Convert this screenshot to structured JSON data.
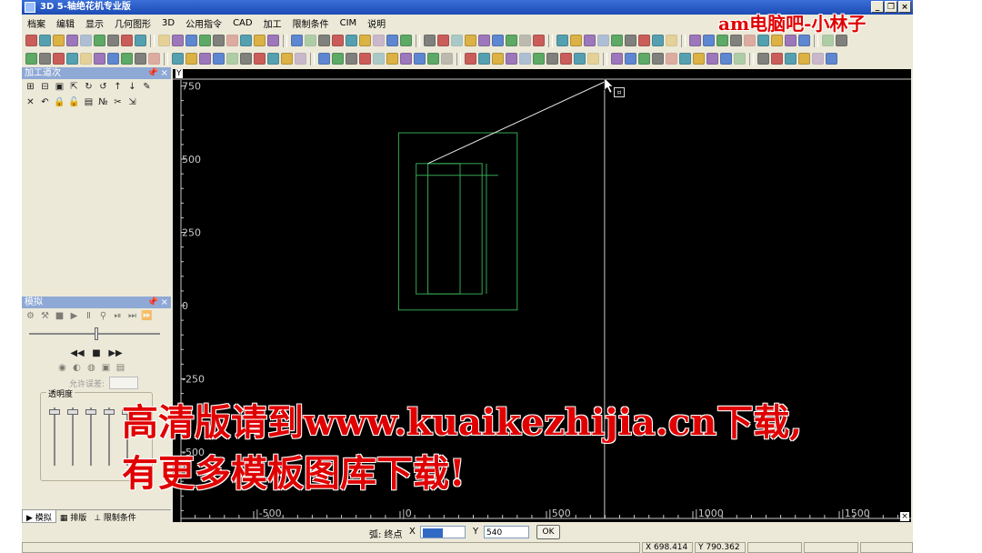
{
  "title_bar": {
    "title": "3D 5-轴绝花机专业版",
    "buttons": [
      "_",
      "❐",
      "×"
    ]
  },
  "menu": [
    "档案",
    "编辑",
    "显示",
    "几何图形",
    "3D",
    "公用指令",
    "CAD",
    "加工",
    "限制条件",
    "CIM",
    "说明"
  ],
  "panels": {
    "machining": {
      "title": "加工道次",
      "pin": "📌",
      "close": "×"
    },
    "simulation": {
      "title": "模拟",
      "pin": "📌",
      "close": "×",
      "allowed_error_label": "允许误差:",
      "transparency_label": "透明度"
    }
  },
  "bottom_tabs": [
    "模拟",
    "排版",
    "限制条件"
  ],
  "canvas": {
    "y_axis_label": "Y",
    "y_ticks": [
      "750",
      "500",
      "250",
      "0",
      "-250",
      "-500"
    ],
    "x_ticks": [
      "-500",
      "0",
      "500",
      "1000",
      "1500"
    ],
    "close": "×",
    "colors": {
      "background": "#000000",
      "geometry": "#33a852",
      "axis": "#c8c8c8",
      "rubber_band": "#e6e6e6"
    }
  },
  "coord_input": {
    "label": "弧: 终点",
    "x_label": "X",
    "x_value": "",
    "y_label": "Y",
    "y_value": "540",
    "ok_label": "OK"
  },
  "status": {
    "x_readout": "X 698.414",
    "y_readout": "Y 790.362"
  },
  "watermarks": {
    "top_right": "am电脑吧-小林子",
    "line1": "高清版请到www.kuaikezhijia.cn下载,",
    "line2": "有更多模板图库下载!"
  }
}
